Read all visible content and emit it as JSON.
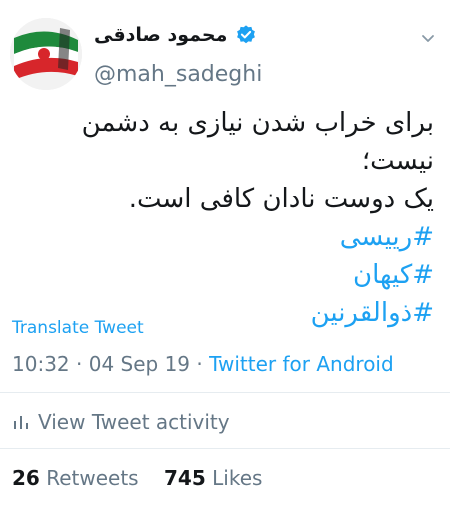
{
  "user": {
    "display_name": "محمود صادقی",
    "handle": "@mah_sadeghi",
    "verified": true
  },
  "tweet": {
    "lines": [
      "برای خراب شدن نیازی به دشمن نیست؛",
      "یک دوست نادان کافی است."
    ],
    "hashtags": [
      "#رییسی",
      "#کیهان",
      "#ذوالقرنین"
    ]
  },
  "translate_label": "Translate Tweet",
  "meta": {
    "time": "10:32",
    "date": "04 Sep 19",
    "client": "Twitter for Android",
    "separator": "·"
  },
  "activity_label": "View Tweet activity",
  "stats": {
    "retweets_count": "26",
    "retweets_label": "Retweets",
    "likes_count": "745",
    "likes_label": "Likes"
  },
  "colors": {
    "link": "#1da1f2",
    "secondary_text": "#657786",
    "primary_text": "#14171a",
    "divider": "#e6ecf0"
  },
  "icons": [
    "chevron-down-icon",
    "verified-badge-icon",
    "activity-bars-icon"
  ]
}
